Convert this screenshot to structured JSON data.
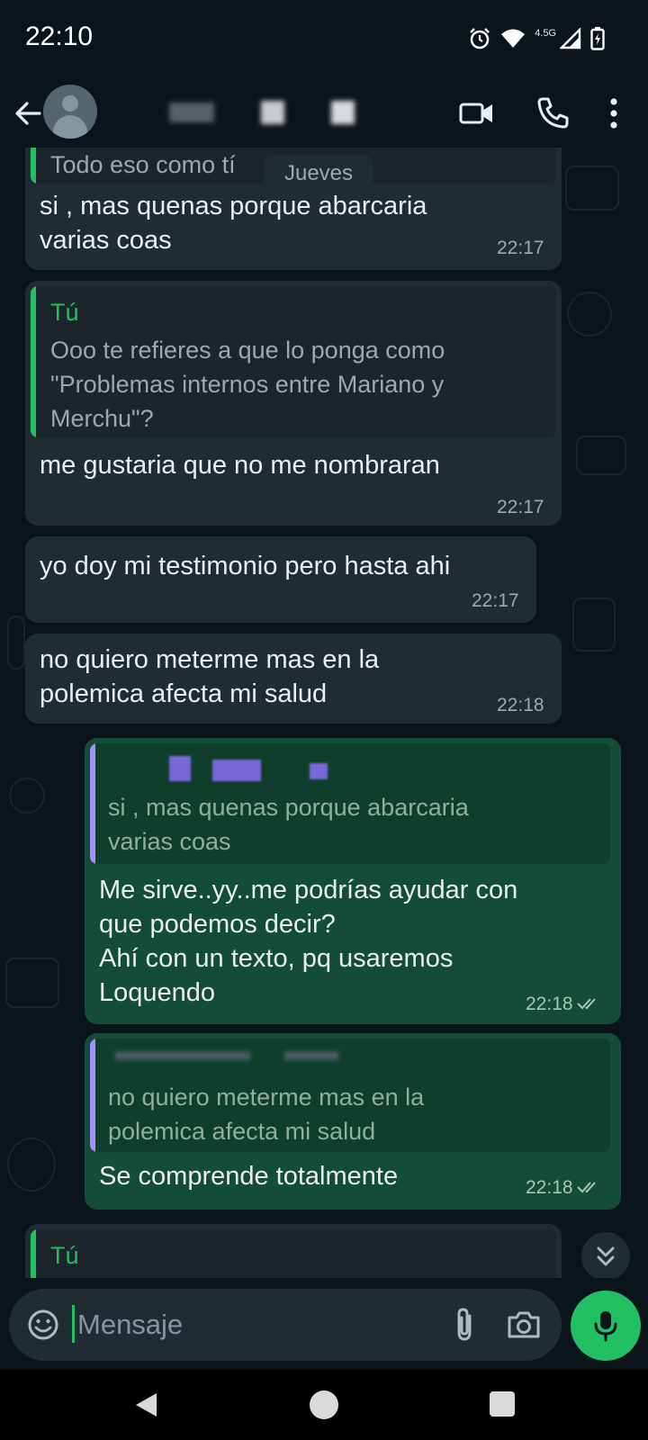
{
  "status_bar": {
    "time": "22:10",
    "network_label": "4.5G"
  },
  "header": {
    "back_icon": "arrow-left-icon",
    "contact_name_redacted": true,
    "icons": [
      "video-call-icon",
      "phone-icon",
      "more-vert-icon"
    ]
  },
  "chat": {
    "date_pill": "Jueves",
    "messages": [
      {
        "direction": "in",
        "quote_text": "Todo eso como tí",
        "text_lines": [
          "si , mas quenas porque abarcaria",
          "varias coas"
        ],
        "time": "22:17"
      },
      {
        "direction": "in",
        "quote_name": "Tú",
        "quote_text_lines": [
          "Ooo te refieres a que lo ponga como",
          "\"Problemas internos entre Mariano y",
          "Merchu\"?"
        ],
        "text": "me gustaria que no me nombraran",
        "time": "22:17"
      },
      {
        "direction": "in",
        "text": "yo doy mi testimonio pero hasta ahi",
        "time": "22:17"
      },
      {
        "direction": "in",
        "text_lines": [
          "no quiero meterme mas en la",
          "polemica afecta mi salud"
        ],
        "time": "22:18"
      },
      {
        "direction": "out",
        "quote_text_lines": [
          "si , mas quenas porque abarcaria",
          "varias coas"
        ],
        "text_lines": [
          "Me sirve..yy..me podrías ayudar con",
          "que podemos decir?",
          "Ahí con un texto, pq usaremos",
          "Loquendo"
        ],
        "time": "22:18",
        "status": "read"
      },
      {
        "direction": "out",
        "quote_text_lines": [
          "no quiero meterme mas en la",
          "polemica afecta mi salud"
        ],
        "text": "Se comprende totalmente",
        "time": "22:18",
        "status": "read"
      },
      {
        "direction": "in",
        "quote_name": "Tú"
      }
    ]
  },
  "composer": {
    "placeholder": "Mensaje",
    "icons": [
      "emoji-icon",
      "attach-icon",
      "camera-icon",
      "mic-icon"
    ]
  },
  "colors": {
    "background": "#0b141a",
    "incoming_bubble": "#202c33",
    "outgoing_bubble": "#144d37",
    "accent_green": "#21c063",
    "quote_purple": "#a48ffc"
  }
}
